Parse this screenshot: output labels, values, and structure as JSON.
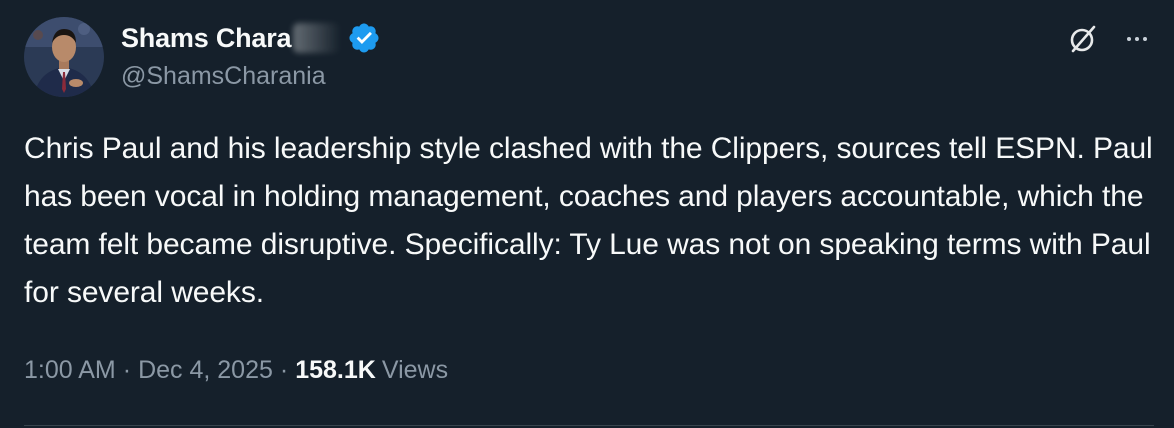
{
  "author": {
    "display_name": "Shams Chara",
    "handle": "@ShamsCharania",
    "verified_icon": "verified-badge-icon",
    "verified_color": "#1d9bf0"
  },
  "tweet": {
    "text": "Chris Paul and his leadership style clashed with the Clippers, sources tell ESPN. Paul has been vocal in holding management, coaches and players accountable, which the team felt became disruptive. Specifically: Ty Lue was not on speaking terms with Paul for several weeks."
  },
  "meta": {
    "time": "1:00 AM",
    "separator": "·",
    "date": "Dec 4, 2025",
    "views_count": "158.1K",
    "views_label": "Views"
  },
  "actions": {
    "grok_icon": "grok-icon",
    "more_icon": "more-options-icon"
  },
  "theme": {
    "background": "#15202b",
    "text_primary": "#f7f9f9",
    "text_secondary": "#8b98a5"
  }
}
